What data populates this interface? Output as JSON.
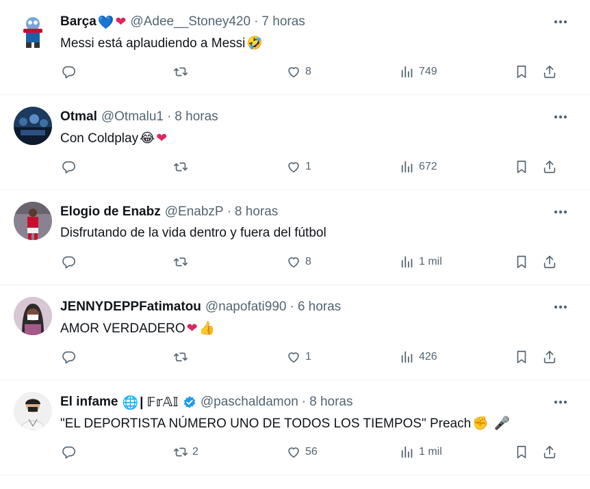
{
  "tweets": [
    {
      "name": "Barça",
      "name_emoji_1": "💙",
      "name_emoji_2": "❤",
      "handle": "@Adee__Stoney420",
      "time": "7 horas",
      "text": "Messi está aplaudiendo a Messi",
      "text_emoji": "🤣",
      "replies": "",
      "retweets": "",
      "likes": "8",
      "views": "749",
      "avatar_colors": [
        "#e9f0f7",
        "#1f5fa8",
        "#c8102e"
      ]
    },
    {
      "name": "Otmal",
      "handle": "@Otmalu1",
      "time": "8 horas",
      "text": "Con Coldplay",
      "text_emoji_1": "😂",
      "text_emoji_2": "❤",
      "replies": "",
      "retweets": "",
      "likes": "1",
      "views": "672",
      "avatar_colors": [
        "#1d3a5f",
        "#3d6fa3",
        "#0d1b2e"
      ]
    },
    {
      "name": "Elogio de Enabz",
      "handle": "@EnabzP",
      "time": "8 horas",
      "text": "Disfrutando de la vida dentro y fuera del fútbol",
      "replies": "",
      "retweets": "",
      "likes": "8",
      "views": "1 mil",
      "avatar_colors": [
        "#7a6f78",
        "#c8102e",
        "#f2f2f2"
      ]
    },
    {
      "name": "JENNYDEPPFatimatou",
      "handle": "@napofati990",
      "time": "6 horas",
      "text": "AMOR VERDADERO",
      "text_emoji_1": "❤",
      "text_emoji_2": "👍",
      "replies": "",
      "retweets": "",
      "likes": "1",
      "views": "426",
      "avatar_colors": [
        "#d8c6d4",
        "#a55a8a",
        "#2b2b2b"
      ]
    },
    {
      "name": "El infame",
      "name_emoji_1": "🌐",
      "name_suffix": "| 𝔽𝕣𝔸𝕀",
      "verified": true,
      "handle": "@paschaldamon",
      "time": "8 horas",
      "text": "\"EL DEPORTISTA NÚMERO UNO DE TODOS LOS TIEMPOS\" Preach",
      "text_emoji_1": "✊",
      "text_emoji_2": "🎤",
      "replies": "",
      "retweets": "2",
      "likes": "56",
      "views": "1 mil",
      "avatar_colors": [
        "#f0f0f0",
        "#222222",
        "#d9b08c"
      ]
    }
  ],
  "separator": "·",
  "icons": {
    "reply": "reply-icon",
    "retweet": "retweet-icon",
    "like": "heart-icon",
    "views": "views-icon",
    "bookmark": "bookmark-icon",
    "share": "share-icon",
    "more": "more-icon"
  },
  "colors": {
    "text": "#0f1419",
    "secondary": "#536471",
    "divider": "#eff3f4",
    "verified": "#1d9bf0"
  }
}
